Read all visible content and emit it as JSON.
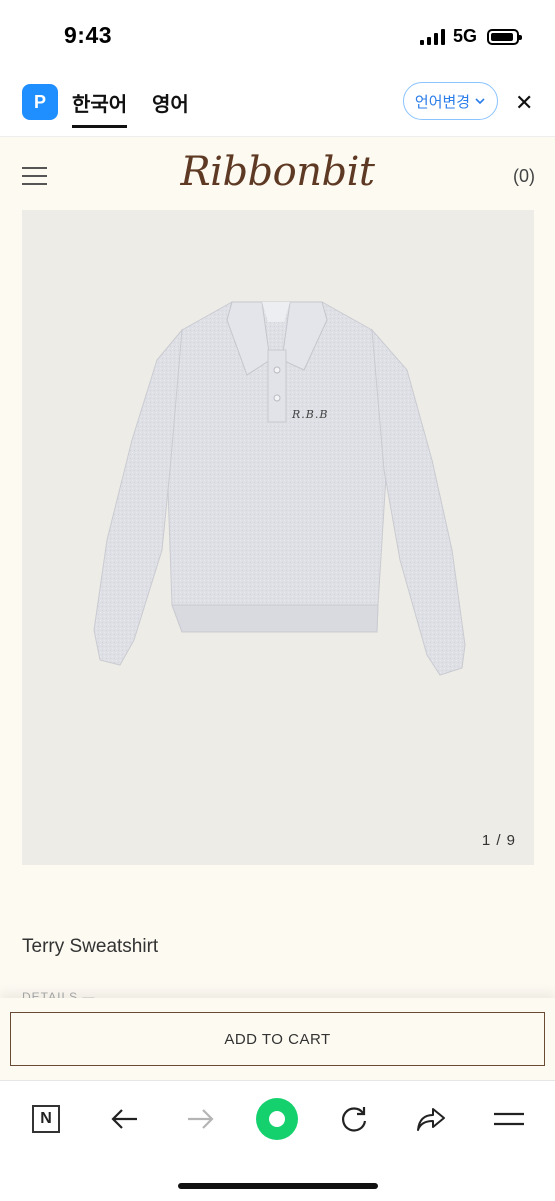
{
  "status": {
    "time": "9:43",
    "network": "5G"
  },
  "translate_bar": {
    "logo_glyph": "P",
    "tabs": [
      {
        "label": "한국어",
        "active": true
      },
      {
        "label": "영어",
        "active": false
      }
    ],
    "change_label": "언어변경",
    "close_glyph": "✕"
  },
  "site": {
    "logo": "Ribbonbit",
    "cart_count": "(0)"
  },
  "product": {
    "image_counter": "1 / 9",
    "title": "Terry Sweatshirt",
    "details_label": "DETAILS  —",
    "embroidery": "R.B.B"
  },
  "cart": {
    "add_label": "ADD TO CART"
  },
  "toolbar": {
    "n_label": "N"
  },
  "colors": {
    "page_bg": "#fdfaf2",
    "logo_brown": "#5e3a24",
    "cart_border": "#6a4a35",
    "lang_blue": "#2b7de9",
    "green": "#14d16e"
  }
}
